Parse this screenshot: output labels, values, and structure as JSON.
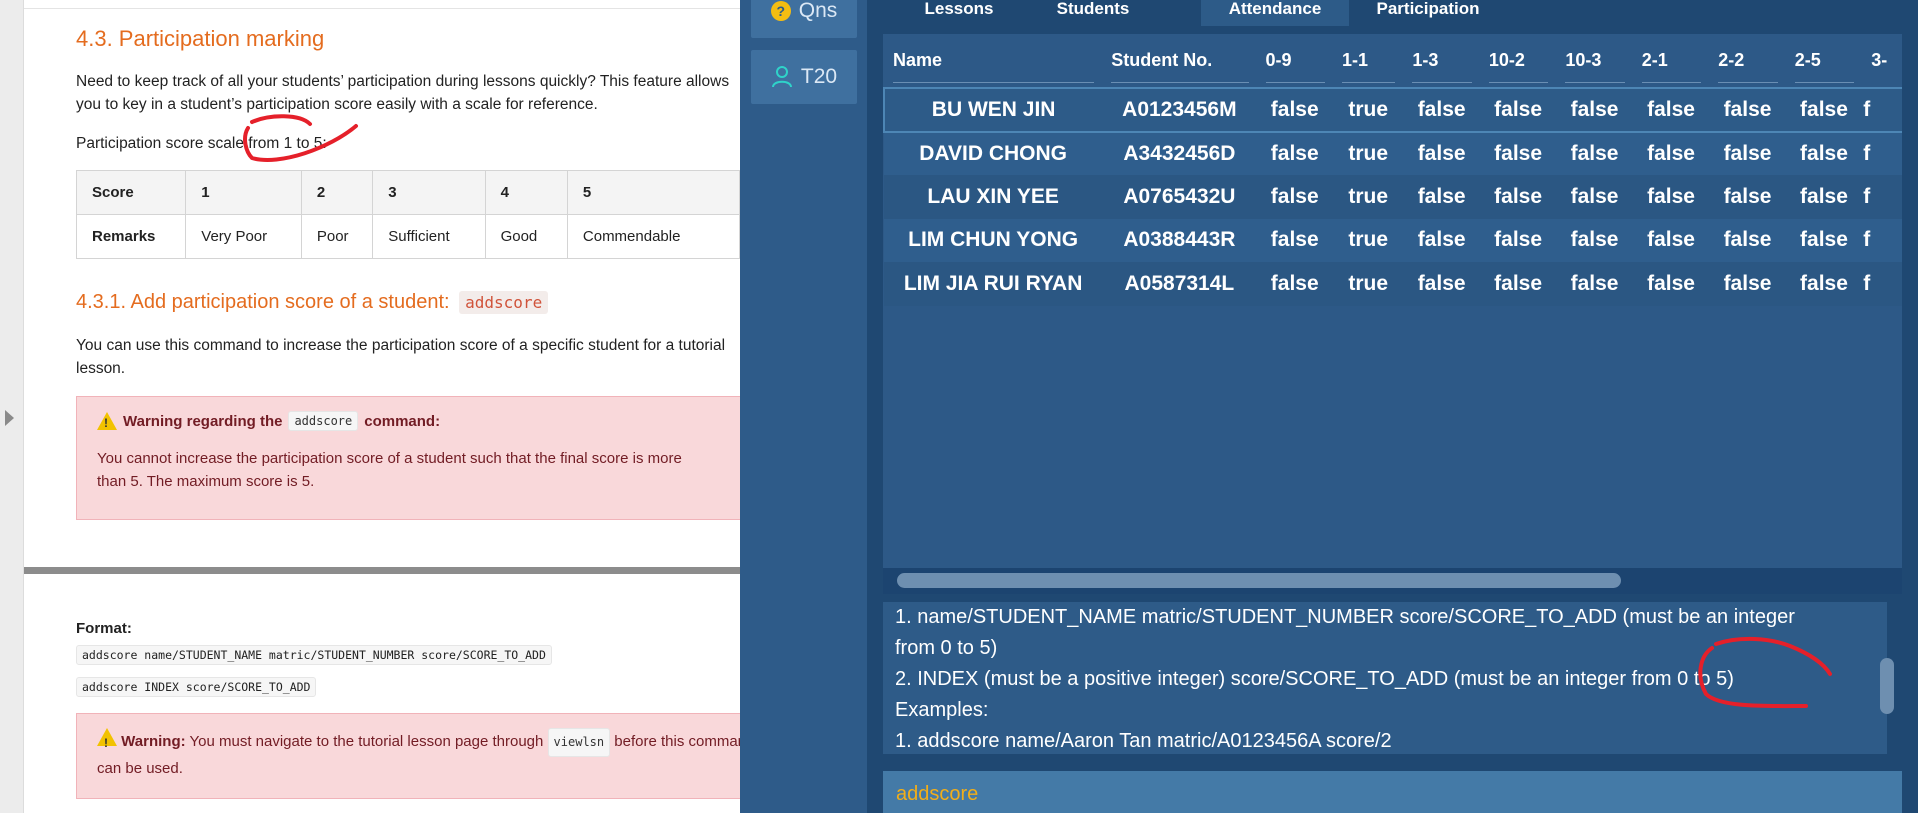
{
  "doc": {
    "heading_43": "4.3. Participation marking",
    "intro": "Need to keep track of all your students’ participation during lessons quickly? This feature allows you to key in a student’s participation score easily with a scale for reference.",
    "scale_label": "Participation score scale from 1 to 5:",
    "score_table": {
      "header": [
        "Score",
        "1",
        "2",
        "3",
        "4",
        "5"
      ],
      "remarks": [
        "Remarks",
        "Very Poor",
        "Poor",
        "Sufficient",
        "Good",
        "Commendable"
      ]
    },
    "heading_431": "4.3.1. Add participation score of a student:",
    "heading_431_code": "addscore",
    "cmd_desc": "You can use this command to increase the participation score of a specific student for a tutorial lesson.",
    "warning1": {
      "title_prefix": "Warning regarding the",
      "title_code": "addscore",
      "title_suffix": "command:",
      "body": "You cannot increase the participation score of a student such that the final score is more than 5. The maximum score is 5."
    },
    "format_label": "Format:",
    "format_1": "addscore name/STUDENT_NAME matric/STUDENT_NUMBER score/SCORE_TO_ADD",
    "format_2": "addscore INDEX score/SCORE_TO_ADD",
    "warning2": {
      "strong": "Warning:",
      "text_before": "You must navigate to the tutorial lesson page through",
      "code": "viewlsn",
      "text_after": "before this command can be used."
    }
  },
  "app": {
    "sidebar": {
      "qns_label": "Qns",
      "t20_label": "T20"
    },
    "tabs": [
      "Lessons",
      "Students",
      "Attendance",
      "Participation"
    ],
    "active_tab": "Attendance",
    "attendance_table": {
      "columns": [
        "Name",
        "Student No.",
        "0-9",
        "1-1",
        "1-3",
        "10-2",
        "10-3",
        "2-1",
        "2-2",
        "2-5",
        "3-"
      ],
      "rows": [
        [
          "BU WEN JIN",
          "A0123456M",
          "false",
          "true",
          "false",
          "false",
          "false",
          "false",
          "false",
          "false",
          "f"
        ],
        [
          "DAVID CHONG",
          "A3432456D",
          "false",
          "true",
          "false",
          "false",
          "false",
          "false",
          "false",
          "false",
          "f"
        ],
        [
          "LAU XIN YEE",
          "A0765432U",
          "false",
          "true",
          "false",
          "false",
          "false",
          "false",
          "false",
          "false",
          "f"
        ],
        [
          "LIM CHUN YONG",
          "A0388443R",
          "false",
          "true",
          "false",
          "false",
          "false",
          "false",
          "false",
          "false",
          "f"
        ],
        [
          "LIM JIA RUI RYAN",
          "A0587314L",
          "false",
          "true",
          "false",
          "false",
          "false",
          "false",
          "false",
          "false",
          "f"
        ]
      ]
    },
    "result_lines": [
      "1. name/STUDENT_NAME matric/STUDENT_NUMBER score/SCORE_TO_ADD (must be an integer",
      "from 0 to 5)",
      "2. INDEX (must be a positive integer) score/SCORE_TO_ADD (must be an integer from 0 to 5)",
      "Examples:",
      "1. addscore name/Aaron Tan matric/A0123456A score/2"
    ],
    "command_input": "addscore"
  },
  "colors": {
    "doc_heading": "#e46c1f",
    "warning_bg": "#f9d8da",
    "warning_text": "#721c24",
    "app_bg": "#2d5987",
    "app_main_bg": "#1f4872",
    "command_text": "#f1ae1a",
    "annotation": "#e5202a"
  },
  "icons": {
    "qns": "question-circle-icon",
    "t20": "person-icon",
    "warning": "warning-triangle-icon",
    "gutter": "collapse-arrow-icon"
  }
}
